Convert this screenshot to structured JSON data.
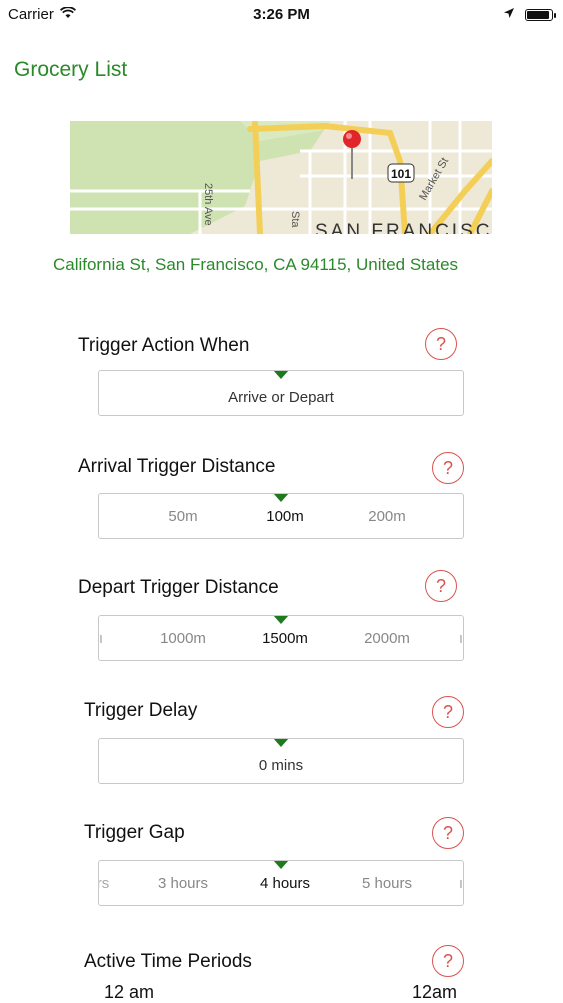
{
  "status_bar": {
    "carrier": "Carrier",
    "time": "3:26 PM"
  },
  "nav": {
    "title": "Grocery List"
  },
  "map": {
    "labels": {
      "street_a": "25th Ave",
      "street_b": "Sta",
      "highway": "101",
      "market": "Market St",
      "city": "SAN FRANCISCO"
    }
  },
  "address": "California St, San Francisco, CA  94115, United States",
  "sections": {
    "trigger_action": {
      "label": "Trigger Action When",
      "value": "Arrive or Depart"
    },
    "arrival_distance": {
      "label": "Arrival Trigger Distance",
      "options": [
        "50m",
        "100m",
        "200m"
      ],
      "selected": "100m"
    },
    "depart_distance": {
      "label": "Depart Trigger Distance",
      "options": [
        "1000m",
        "1500m",
        "2000m"
      ],
      "selected": "1500m"
    },
    "trigger_delay": {
      "label": "Trigger Delay",
      "value": "0 mins"
    },
    "trigger_gap": {
      "label": "Trigger Gap",
      "options": [
        "3 hours",
        "4 hours",
        "5 hours"
      ],
      "selected": "4 hours"
    },
    "active_periods": {
      "label": "Active Time Periods",
      "start": "12 am",
      "end": "12am"
    }
  },
  "help_symbol": "?",
  "colors": {
    "accent_green": "#2a8a2a",
    "marker_green": "#1f7a1f",
    "help_red": "#d9534f"
  }
}
